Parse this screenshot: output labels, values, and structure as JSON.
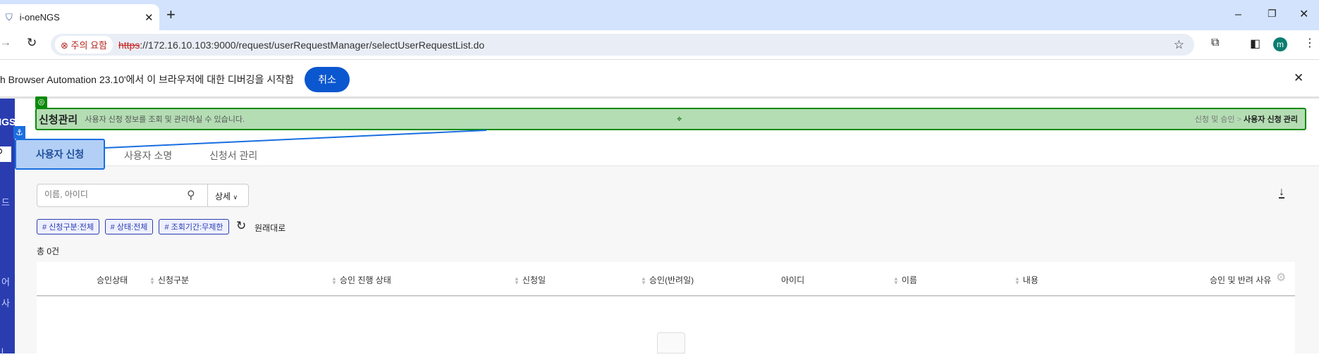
{
  "browser": {
    "tab_title": "i-oneNGS",
    "new_tab": "+",
    "security_label": "주의 요함",
    "url_scheme": "https",
    "url_rest": "://172.16.10.103:9000/request/userRequestManager/selectUserRequestList.do",
    "profile_initial": "m"
  },
  "infobar": {
    "message": "h Browser Automation 23.10'에서 이 브라우저에 대한 디버깅을 시작함",
    "cancel_label": "취소"
  },
  "sidebar": {
    "logo": "NGS",
    "items": [
      "드",
      "어",
      "사",
      "l"
    ]
  },
  "header": {
    "title": "신청관리",
    "description": "사용자 신청 정보를 조회 및 관리하실 수 있습니다.",
    "breadcrumb_parent": "신청 및 승인",
    "breadcrumb_sep": ">",
    "breadcrumb_current": "사용자 신청 관리"
  },
  "tabs": [
    {
      "label": "사용자 신청",
      "active": true
    },
    {
      "label": "사용자 소명"
    },
    {
      "label": "신청서 관리"
    }
  ],
  "search": {
    "placeholder": "이름, 아이디",
    "detail_label": "상세"
  },
  "filters": [
    "# 신청구분:전체",
    "# 상태:전체",
    "# 조회기간:무제한"
  ],
  "reset_label": "원래대로",
  "total": "총 0건",
  "columns": [
    "승인상태",
    "신청구분",
    "승인 진행 상태",
    "신청일",
    "승인(반려일)",
    "아이디",
    "이름",
    "내용",
    "승인 및 반려 사유"
  ],
  "colors": {
    "sidebar": "#2a3db0",
    "accent": "#0b57d0",
    "highlight_green": "#b4ddb4"
  }
}
